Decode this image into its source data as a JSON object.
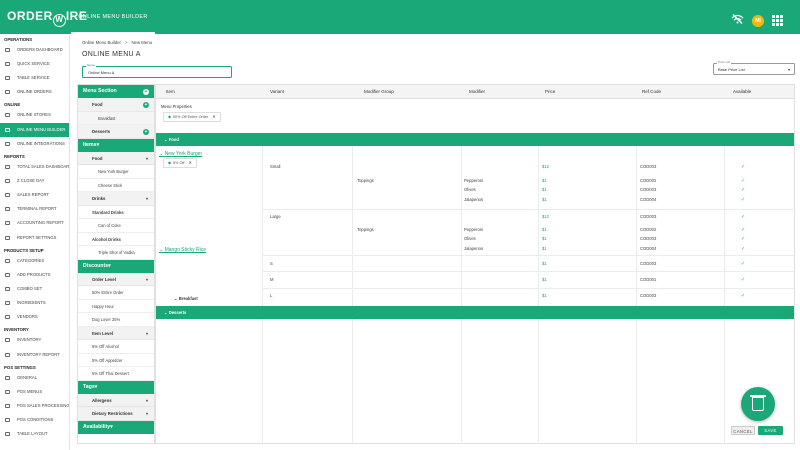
{
  "brand": {
    "name_left": "ORDER",
    "name_ring": "W",
    "name_right": "IRE",
    "accent": "#1aa878"
  },
  "topbar": {
    "module_tab": "ONLINE MENU BUILDER",
    "avatar_initials": "MI"
  },
  "sidebar": {
    "sections": [
      {
        "title": "OPERATIONS",
        "items": [
          {
            "label": "ORDERS DASHBOARD"
          },
          {
            "label": "QUICK SERVICE"
          },
          {
            "label": "TABLE SERVICE"
          },
          {
            "label": "ONLINE ORDERS"
          }
        ]
      },
      {
        "title": "ONLINE",
        "items": [
          {
            "label": "ONLINE STORES"
          },
          {
            "label": "ONLINE MENU BUILDER",
            "active": true
          },
          {
            "label": "ONLINE INTEGRATIONS"
          }
        ]
      },
      {
        "title": "REPORTS",
        "items": [
          {
            "label": "TOTAL SALES DASHBOARD"
          },
          {
            "label": "Z CLOSE DAY"
          },
          {
            "label": "SALES REPORT"
          },
          {
            "label": "TERMINAL REPORT"
          },
          {
            "label": "ACCOUNTING REPORT"
          },
          {
            "label": "REPORT SETTINGS"
          }
        ]
      },
      {
        "title": "PRODUCTS SETUP",
        "items": [
          {
            "label": "CATEGORIES"
          },
          {
            "label": "ADD PRODUCTS"
          },
          {
            "label": "COMBO SET"
          },
          {
            "label": "INGREDIENTS"
          },
          {
            "label": "VENDORS"
          }
        ]
      },
      {
        "title": "INVENTORY",
        "items": [
          {
            "label": "INVENTORY"
          },
          {
            "label": "INVENTORY REPORT"
          }
        ]
      },
      {
        "title": "POS SETTINGS",
        "items": [
          {
            "label": "GENERAL"
          },
          {
            "label": "POS MENUS"
          },
          {
            "label": "POS SALES PROCESSING"
          },
          {
            "label": "POS CONDITIONS"
          },
          {
            "label": "TABLE LAYOUT"
          }
        ]
      }
    ]
  },
  "breadcrumb": {
    "parent": "Online Menu Builder",
    "current": "New Menu"
  },
  "page": {
    "title": "ONLINE MENU A"
  },
  "menu_name": {
    "label": "Name",
    "value": "Online Menu A"
  },
  "price_list": {
    "label": "Price List",
    "value": "Base Price List"
  },
  "left_panel": {
    "menu_section": {
      "title": "Menu Section",
      "groups": [
        {
          "label": "Food",
          "rows": [
            "Breakfast"
          ]
        },
        {
          "label": "Desserts",
          "rows": []
        }
      ]
    },
    "items": {
      "title": "Items",
      "groups": [
        {
          "label": "Food",
          "rows": [
            "New York Burger",
            "Cheese Stick"
          ]
        },
        {
          "label": "Drinks",
          "rows": []
        },
        {
          "label": "Standard Drinks",
          "rows": [
            "Can of Coke"
          ]
        },
        {
          "label": "Alcohol Drinks",
          "rows": [
            "Triple Shot of Vodka"
          ]
        }
      ]
    },
    "discounts": {
      "title": "Discounts",
      "groups": [
        {
          "label": "Order Level",
          "rows": [
            "50% Entire Order",
            "Happy Hour",
            "Dog Lover 25%"
          ]
        },
        {
          "label": "Item Level",
          "rows": [
            "5% Off Alcohol",
            "5% Off Appetizer",
            "5% Off Thai Dessert"
          ]
        }
      ]
    },
    "tags": {
      "title": "Tags",
      "groups": [
        {
          "label": "Allergens"
        },
        {
          "label": "Dietary Restrictions"
        }
      ]
    },
    "availability": {
      "title": "Availability"
    }
  },
  "table": {
    "columns": [
      "Item",
      "Variant",
      "Modifier Group",
      "Modifier",
      "Price",
      "Ref.Code",
      "Available"
    ],
    "menu_properties": {
      "label": "Menu Properties",
      "chip": "50% Off Entire Order"
    },
    "sections": {
      "food": "Food",
      "desserts": "Desserts",
      "breakfast": "Breakfast"
    },
    "items": {
      "burger": "New York Burger",
      "burger_chip": "5% Off",
      "rice": "Mango Sticky Rice"
    },
    "burger_rows": [
      {
        "variant": "Small",
        "price": "$12",
        "code": "COD003"
      },
      {
        "group": "Toppings",
        "modifier": "Pepperoni",
        "price": "$1",
        "code": "COD002"
      },
      {
        "modifier": "Olives",
        "price": "$1",
        "code": "COD003"
      },
      {
        "modifier": "Jalapenos",
        "price": "$1",
        "code": "COD004"
      },
      {
        "variant": "Large",
        "price": "$12",
        "code": "COD003"
      },
      {
        "group": "Toppings",
        "modifier": "Pepperoni",
        "price": "$1",
        "code": "COD002"
      },
      {
        "modifier": "Olives",
        "price": "$1",
        "code": "COD003"
      },
      {
        "modifier": "Jalapenos",
        "price": "$1",
        "code": "COD004"
      }
    ],
    "rice_rows": [
      {
        "variant": "S",
        "price": "$1",
        "code": "COD003"
      },
      {
        "variant": "M",
        "price": "$1",
        "code": "COD001"
      },
      {
        "variant": "L",
        "price": "$1",
        "code": "COD003"
      }
    ],
    "check": "✓"
  },
  "actions": {
    "cancel": "CANCEL",
    "save": "SAVE"
  }
}
